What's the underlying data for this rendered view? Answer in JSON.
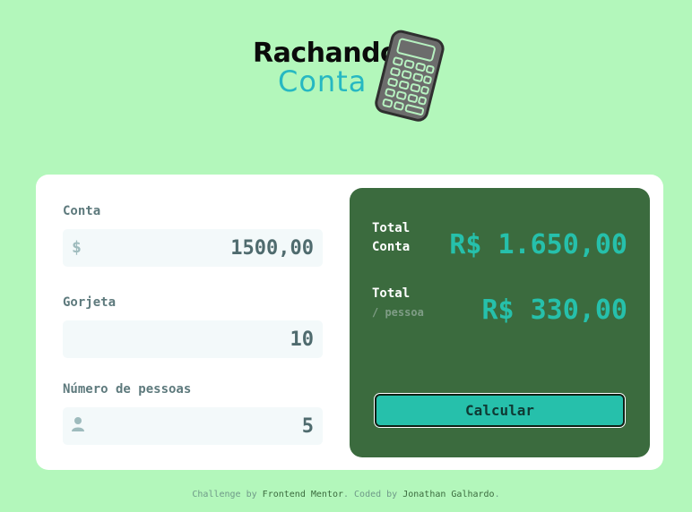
{
  "logo": {
    "line1": "Rachando",
    "line2": "Conta"
  },
  "form": {
    "bill": {
      "label": "Conta",
      "icon": "dollar-icon",
      "icon_glyph": "$",
      "value": "1500,00"
    },
    "tip": {
      "label": "Gorjeta",
      "value": "10"
    },
    "people": {
      "label": "Número de pessoas",
      "icon": "person-icon",
      "value": "5"
    }
  },
  "result": {
    "total": {
      "label_line1": "Total",
      "label_line2": "Conta",
      "value": "R$ 1.650,00"
    },
    "per_person": {
      "label_line1": "Total",
      "label_line2": "/ pessoa",
      "value": "R$ 330,00"
    },
    "button_label": "Calcular"
  },
  "footer": {
    "prefix": "Challenge by ",
    "link1": "Frontend Mentor",
    "middle": ". Coded by ",
    "link2": "Jonathan Galhardo",
    "suffix": "."
  },
  "colors": {
    "background": "#b3f7bb",
    "panel": "#3b6b3e",
    "accent": "#26c0ab",
    "logo_accent": "#26b8c2"
  }
}
